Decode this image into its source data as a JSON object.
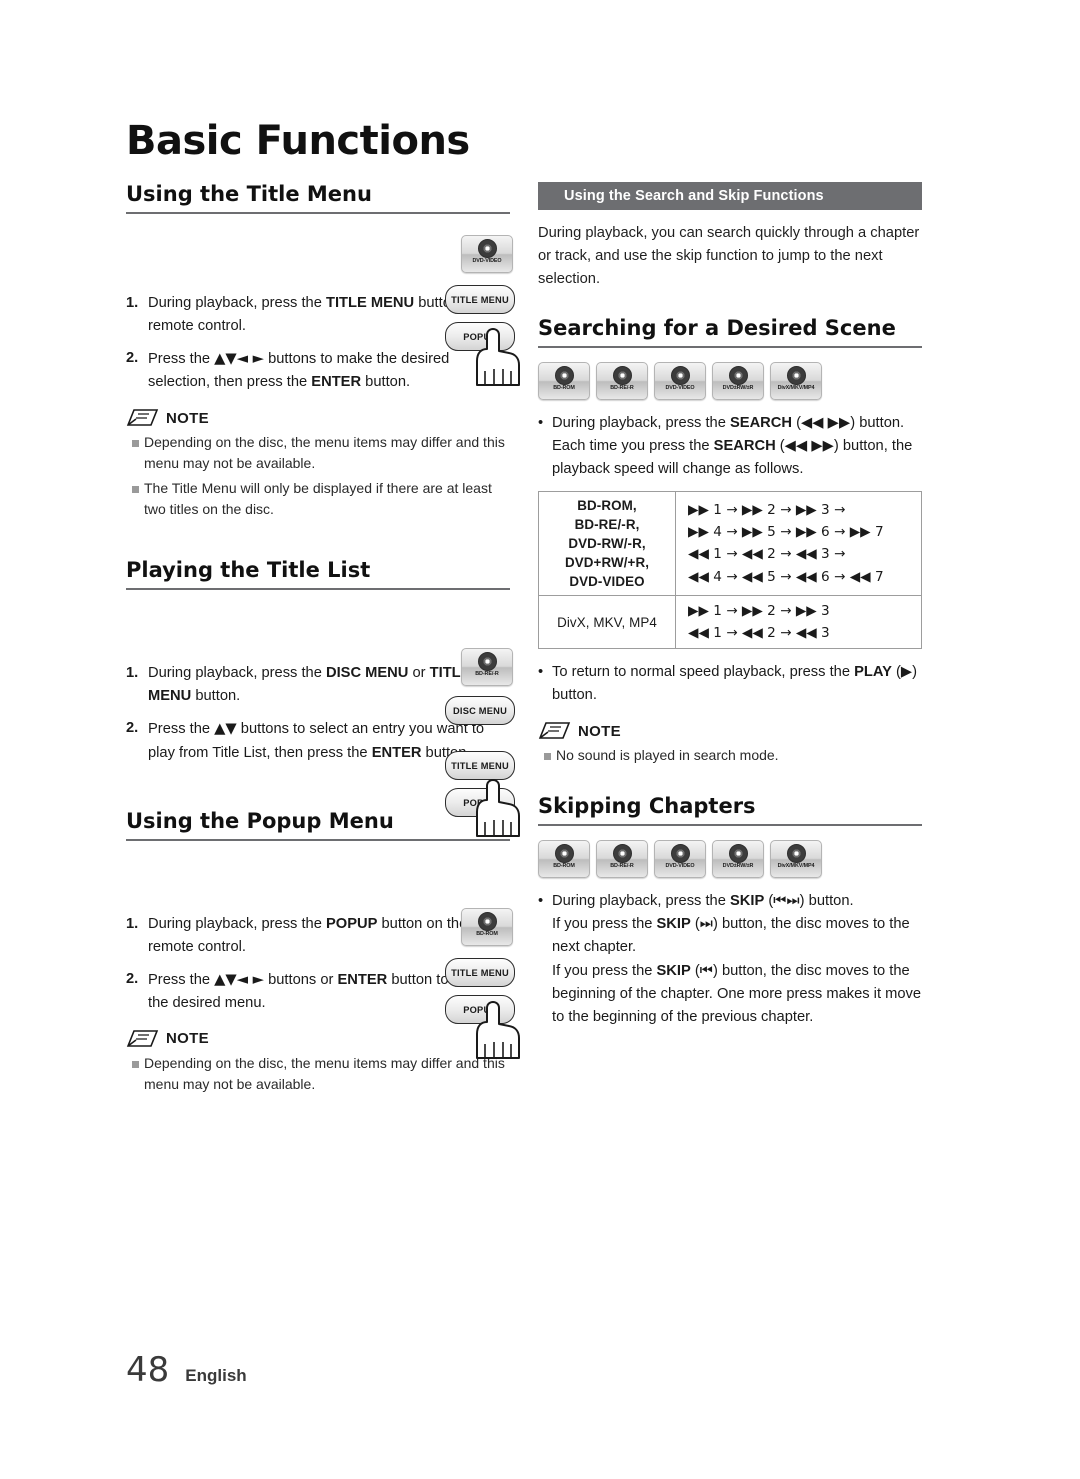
{
  "chapter": {
    "title": "Basic Functions"
  },
  "footer": {
    "page_number": "48",
    "language": "English"
  },
  "left": {
    "section1": {
      "heading": "Using the Title Menu",
      "steps": [
        {
          "n": "1.",
          "text_parts": [
            "During playback, press the ",
            "TITLE MENU",
            " button on the remote control."
          ]
        },
        {
          "n": "2.",
          "text_parts": [
            "Press the ",
            "▲▼◄ ►",
            " buttons to make the desired selection, then press the ",
            "ENTER",
            " button."
          ]
        }
      ],
      "note_label": "NOTE",
      "notes": [
        "Depending on the disc, the menu items may differ and this menu may not be available.",
        "The Title Menu will only be displayed if there are at least two titles on the disc."
      ],
      "keys": [
        "TITLE MENU",
        "POPUP"
      ],
      "disc_badge": "DVD-VIDEO"
    },
    "section2": {
      "heading": "Playing the Title List",
      "steps": [
        {
          "n": "1.",
          "text_parts": [
            "During playback, press the ",
            "DISC MENU",
            " or ",
            "TITLE MENU",
            " button."
          ]
        },
        {
          "n": "2.",
          "text_parts": [
            "Press the ",
            "▲▼",
            " buttons to select an entry you want to play from Title List, then press the ",
            "ENTER",
            " button."
          ]
        }
      ],
      "keys": [
        "DISC MENU",
        "TITLE MENU",
        "POPUP"
      ],
      "disc_badge": "BD-RE/-R"
    },
    "section3": {
      "heading": "Using the Popup Menu",
      "steps": [
        {
          "n": "1.",
          "text_parts": [
            "During playback, press the ",
            "POPUP",
            " button on the remote control."
          ]
        },
        {
          "n": "2.",
          "text_parts": [
            "Press the ",
            "▲▼◄ ►",
            " buttons or ",
            "ENTER",
            " button to select the desired menu."
          ]
        }
      ],
      "note_label": "NOTE",
      "notes": [
        "Depending on the disc, the menu items may differ and this menu may not be available."
      ],
      "keys": [
        "TITLE MENU",
        "POPUP"
      ],
      "disc_badge": "BD-ROM"
    }
  },
  "right": {
    "banner": "Using the Search and Skip Functions",
    "intro": "During playback, you can search quickly through a chapter or track, and use the skip function to jump to the next selection.",
    "section_search": {
      "heading": "Searching for a Desired Scene",
      "badges": [
        "BD-ROM",
        "BD-RE/-R",
        "DVD-VIDEO",
        "DVD±RW/±R",
        "DivX/MKV/MP4"
      ],
      "bullet_parts": [
        "During playback, press the ",
        "SEARCH",
        " (◀◀ ▶▶) button.",
        "Each time you press the ",
        "SEARCH",
        " (◀◀ ▶▶) button, the playback speed will change as follows."
      ],
      "table": {
        "rows": [
          {
            "label": "BD-ROM,\nBD-RE/-R,\nDVD-RW/-R,\nDVD+RW/+R,\nDVD-VIDEO",
            "values": [
              "▶▶ 1 → ▶▶ 2 → ▶▶ 3 →",
              "▶▶ 4 → ▶▶ 5 → ▶▶ 6 → ▶▶ 7",
              "◀◀ 1 → ◀◀ 2 → ◀◀ 3 →",
              "◀◀ 4 → ◀◀ 5 → ◀◀ 6 → ◀◀ 7"
            ]
          },
          {
            "label": "DivX, MKV, MP4",
            "values": [
              "▶▶ 1 → ▶▶ 2 → ▶▶ 3",
              "◀◀ 1 → ◀◀ 2 → ◀◀ 3"
            ]
          }
        ]
      },
      "return_bullet_parts": [
        "To return to normal speed playback, press the ",
        "PLAY",
        " (▶) button."
      ],
      "note_label": "NOTE",
      "notes": [
        "No sound is played in search mode."
      ]
    },
    "section_skip": {
      "heading": "Skipping Chapters",
      "badges": [
        "BD-ROM",
        "BD-RE/-R",
        "DVD-VIDEO",
        "DVD±RW/±R",
        "DivX/MKV/MP4"
      ],
      "bullet_parts": [
        "During playback, press the ",
        "SKIP",
        " (⏮⏭) button.",
        "If you press the ",
        "SKIP",
        " (⏭) button, the disc moves to the next chapter.",
        "If you press the ",
        "SKIP",
        " (⏮) button, the disc moves to the beginning of the chapter. One more press makes it move to the beginning of the previous chapter."
      ]
    }
  },
  "colors": {
    "banner_bg": "#6d6e71",
    "rule": "#6d6e71",
    "text": "#1a1a1a"
  }
}
